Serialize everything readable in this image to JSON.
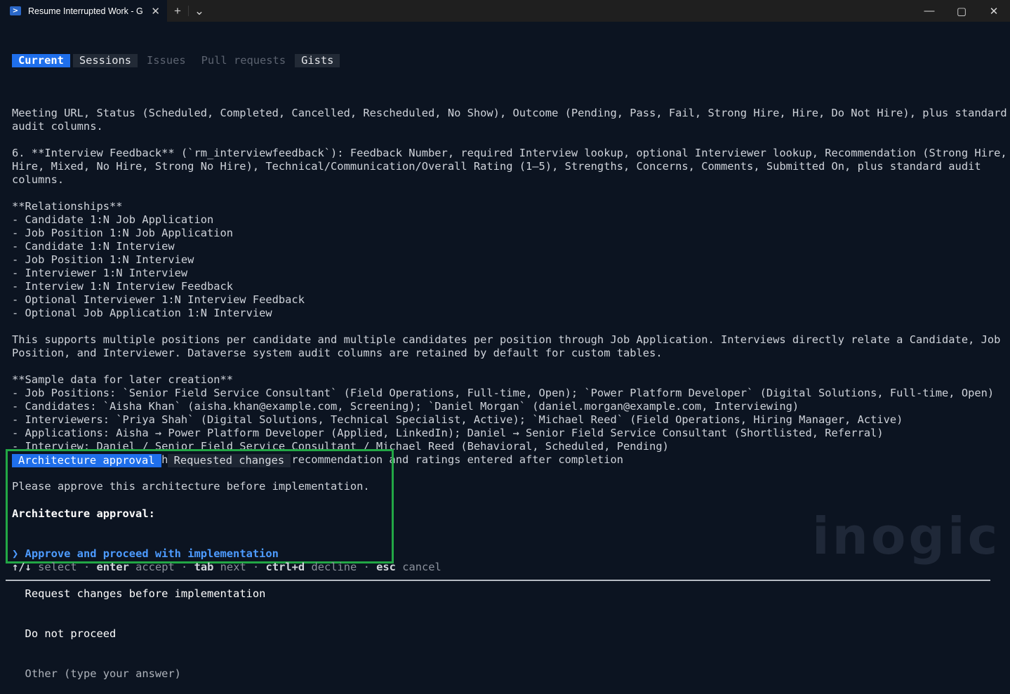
{
  "window": {
    "tab_title": "Resume Interrupted Work - G",
    "tab_icon": "powershell-icon",
    "new_tab_glyph": "+",
    "dropdown_glyph": "⌄",
    "minimize_glyph": "—",
    "maximize_glyph": "▢",
    "close_glyph": "✕",
    "tab_close_glyph": "✕",
    "ps_glyph": ">"
  },
  "nav": {
    "tabs": [
      "Current",
      "Sessions",
      "Issues",
      "Pull requests",
      "Gists"
    ],
    "active_index": 0
  },
  "content": {
    "lines": [
      "Meeting URL, Status (Scheduled, Completed, Cancelled, Rescheduled, No Show), Outcome (Pending, Pass, Fail, Strong Hire, Hire, Do Not Hire), plus standard",
      "audit columns.",
      "",
      "6. **Interview Feedback** (`rm_interviewfeedback`): Feedback Number, required Interview lookup, optional Interviewer lookup, Recommendation (Strong Hire,",
      "Hire, Mixed, No Hire, Strong No Hire), Technical/Communication/Overall Rating (1–5), Strengths, Concerns, Comments, Submitted On, plus standard audit",
      "columns.",
      "",
      "**Relationships**",
      "- Candidate 1:N Job Application",
      "- Job Position 1:N Job Application",
      "- Candidate 1:N Interview",
      "- Job Position 1:N Interview",
      "- Interviewer 1:N Interview",
      "- Interview 1:N Interview Feedback",
      "- Optional Interviewer 1:N Interview Feedback",
      "- Optional Job Application 1:N Interview",
      "",
      "This supports multiple positions per candidate and multiple candidates per position through Job Application. Interviews directly relate a Candidate, Job",
      "Position, and Interviewer. Dataverse system audit columns are retained by default for custom tables.",
      "",
      "**Sample data for later creation**",
      "- Job Positions: `Senior Field Service Consultant` (Field Operations, Full-time, Open); `Power Platform Developer` (Digital Solutions, Full-time, Open)",
      "- Candidates: `Aisha Khan` (aisha.khan@example.com, Screening); `Daniel Morgan` (daniel.morgan@example.com, Interviewing)",
      "- Interviewers: `Priya Shah` (Digital Solutions, Technical Specialist, Active); `Michael Reed` (Field Operations, Hiring Manager, Active)",
      "- Applications: Aisha → Power Platform Developer (Applied, LinkedIn); Daniel → Senior Field Service Consultant (Shortlisted, Referral)",
      "- Interview: Daniel / Senior Field Service Consultant / Michael Reed (Behavioral, Scheduled, Pending)",
      "- Feedback: linked to that interview, with recommendation and ratings entered after completion",
      "",
      "Please approve this architecture before implementation."
    ]
  },
  "approval": {
    "tabs": [
      "Architecture approval",
      "Requested changes"
    ],
    "question": "Architecture approval:",
    "selected_marker": "❯ ",
    "options": [
      "Approve and proceed with implementation",
      "Request changes before implementation",
      "Do not proceed",
      "Other (type your answer)"
    ],
    "selected_index": 0,
    "highlight_color": "#22a745"
  },
  "hints": [
    {
      "key": "↑/↓",
      "action": "select"
    },
    {
      "key": "enter",
      "action": "accept"
    },
    {
      "key": "tab",
      "action": "next"
    },
    {
      "key": "ctrl+d",
      "action": "decline"
    },
    {
      "key": "esc",
      "action": "cancel"
    }
  ],
  "hint_separator": " · ",
  "watermark": "inogic"
}
